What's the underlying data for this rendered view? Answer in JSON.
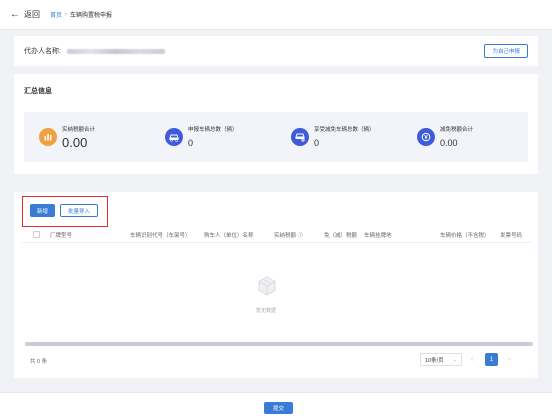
{
  "header": {
    "back_label": "返回",
    "breadcrumb": {
      "home": "首页",
      "separator": "›",
      "current": "车辆购置税申报"
    }
  },
  "agent": {
    "label": "代办人名称:",
    "self_button": "为自己申报"
  },
  "summary": {
    "title": "汇总信息",
    "stats": [
      {
        "label": "实纳税额合计",
        "value": "0.00",
        "icon": "bar-chart-icon",
        "color": "#f0a040"
      },
      {
        "label": "申报车辆总数（辆）",
        "value": "0",
        "icon": "car-icon",
        "color": "#3f5bd9"
      },
      {
        "label": "享受减免车辆总数（辆）",
        "value": "0",
        "icon": "car-discount-icon",
        "color": "#3f5bd9"
      },
      {
        "label": "减免税额合计",
        "value": "0.00",
        "icon": "yen-icon",
        "color": "#3f5bd9"
      }
    ]
  },
  "toolbar": {
    "new_label": "新增",
    "import_label": "批量导入"
  },
  "table": {
    "columns": [
      "厂牌型号",
      "车辆识别代号（车架号）",
      "购车人（单位）名称",
      "实纳税额 ⓘ",
      "免（减）税额",
      "车辆挂牌地",
      "车辆价格（不含税）",
      "发票号码"
    ],
    "empty_text": "暂无数据"
  },
  "pagination": {
    "total": "共 0 条",
    "page_size": "10条/页",
    "prev": "‹",
    "current_page": "1",
    "next": "›"
  },
  "footer": {
    "submit_label": "提交"
  },
  "colors": {
    "primary": "#3a7bd5",
    "highlight": "#e52d27",
    "orange": "#f0a040",
    "indigo": "#3f5bd9"
  }
}
